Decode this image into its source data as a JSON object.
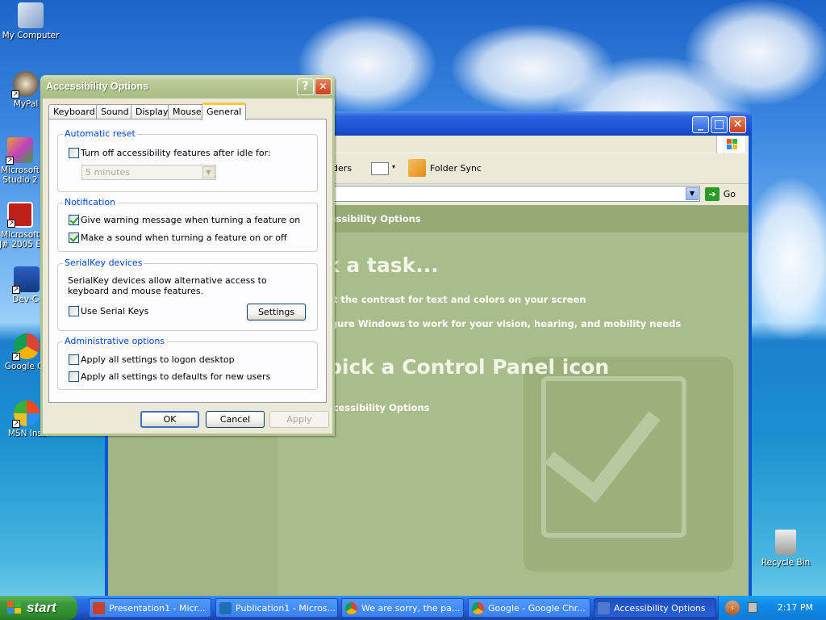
{
  "desktop": {
    "icons": [
      {
        "label": "My Computer"
      },
      {
        "label": "MyPal"
      },
      {
        "label": "Microsoft\nStudio 2"
      },
      {
        "label": "Microsoft\nJ# 2005 E"
      },
      {
        "label": "Dev-C-"
      },
      {
        "label": "Google Ch"
      },
      {
        "label": "MSN Inst"
      },
      {
        "label": "Recycle Bin"
      }
    ]
  },
  "control_panel": {
    "toolbar": {
      "folders_label": "lders",
      "folder_sync_label": "Folder Sync"
    },
    "address": {
      "go_label": "Go"
    },
    "bar_title": "cessibility Options",
    "pick_task": "k a task...",
    "links": [
      "st the contrast for text and colors on your screen",
      "igure Windows to work for your vision, hearing, and mobility needs"
    ],
    "pick_icon": "pick a Control Panel icon",
    "icon_link": "ccessibility Options"
  },
  "dialog": {
    "title": "Accessibility Options",
    "tabs": [
      "Keyboard",
      "Sound",
      "Display",
      "Mouse",
      "General"
    ],
    "active_tab": "General",
    "automatic_reset": {
      "group_label": "Automatic reset",
      "checkbox_label": "Turn off accessibility features after idle for:",
      "checked": false,
      "select_value": "5 minutes"
    },
    "notification": {
      "group_label": "Notification",
      "items": [
        {
          "label": "Give warning message when turning a feature on",
          "checked": true
        },
        {
          "label": "Make a sound when turning a feature on or off",
          "checked": true
        }
      ]
    },
    "serialkey": {
      "group_label": "SerialKey devices",
      "description": "SerialKey devices allow alternative access to keyboard and mouse features.",
      "checkbox_label": "Use Serial Keys",
      "checked": false,
      "settings_label": "Settings"
    },
    "admin": {
      "group_label": "Administrative options",
      "items": [
        {
          "label": "Apply all settings to logon desktop",
          "checked": false
        },
        {
          "label": "Apply all settings to defaults for new users",
          "checked": false
        }
      ]
    },
    "buttons": {
      "ok": "OK",
      "cancel": "Cancel",
      "apply": "Apply"
    },
    "help_glyph": "?",
    "close_glyph": "✕"
  },
  "taskbar": {
    "start_label": "start",
    "tasks": [
      {
        "label": "Presentation1 - Micr...",
        "color": "#c8402a"
      },
      {
        "label": "Publication1 - Micros...",
        "color": "#1f6fb8"
      },
      {
        "label": "We are sorry, the pa...",
        "color": "#e0a020"
      },
      {
        "label": "Google - Google Chr...",
        "color": "#e0a020"
      },
      {
        "label": "Accessibility Options",
        "color": "#4f7ad0",
        "active": true
      }
    ],
    "clock": "2:17 PM"
  },
  "colors": {
    "xp_blue": "#245edb",
    "dialog_title": "#a9bd86",
    "group_label": "#0046d5",
    "start_green": "#3c9b3c"
  }
}
